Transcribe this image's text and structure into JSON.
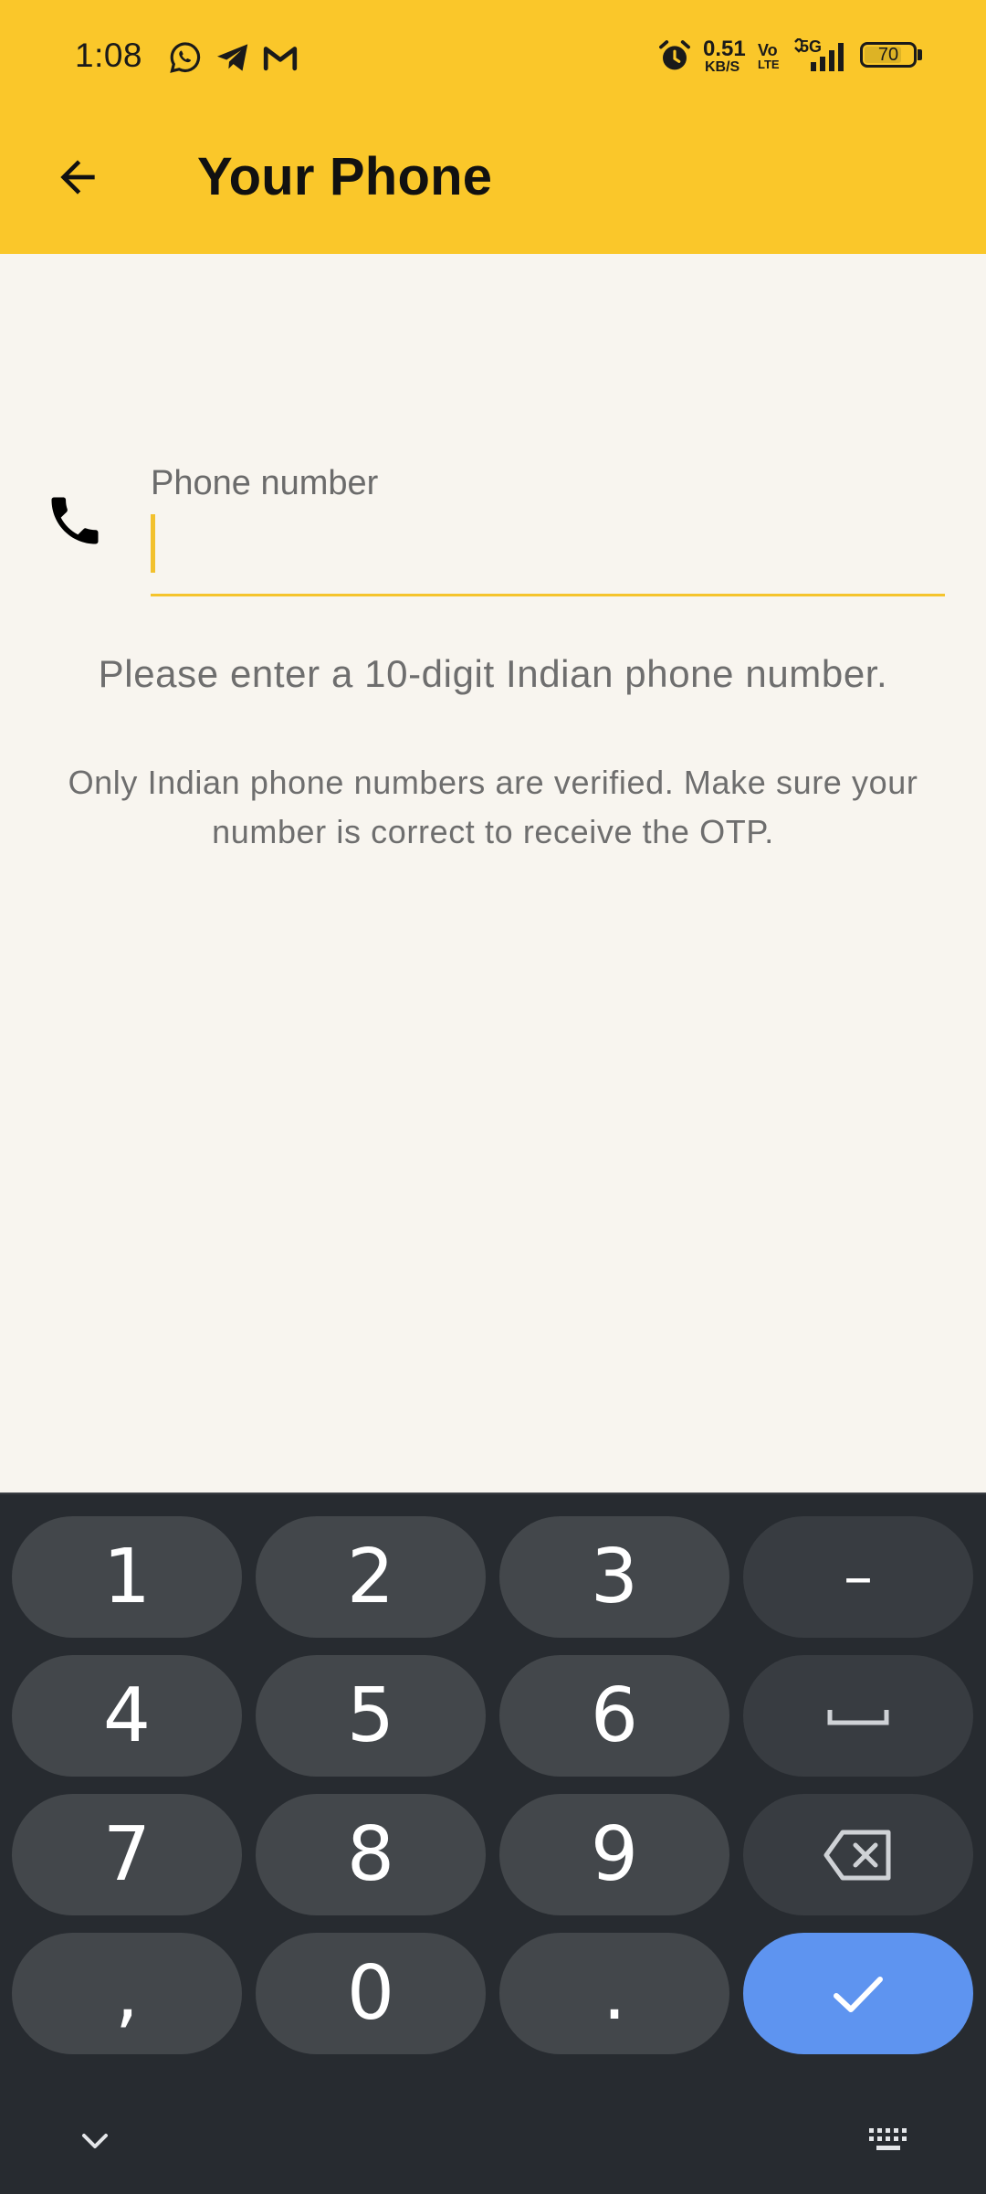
{
  "status_bar": {
    "time": "1:08",
    "notification_icons": [
      "whatsapp-icon",
      "telegram-icon",
      "gmail-icon"
    ],
    "alarm_icon": "alarm-icon",
    "net_speed_value": "0.51",
    "net_speed_unit": "KB/S",
    "volte_top": "Vo",
    "volte_bottom": "LTE",
    "network_label": "5G",
    "battery_level": "70"
  },
  "app_bar": {
    "title": "Your Phone",
    "back_icon": "arrow-back-icon",
    "color": "#FAC72A"
  },
  "form": {
    "phone_label": "Phone number",
    "phone_value": "",
    "phone_icon": "phone-icon",
    "helper_text": "Please enter a 10-digit Indian phone number.",
    "note_text": "Only Indian phone numbers are verified. Make sure your number is correct to receive the OTP.",
    "accent_color": "#F5C42C"
  },
  "keyboard": {
    "keys": {
      "k1": "1",
      "k2": "2",
      "k3": "3",
      "dash": "–",
      "k4": "4",
      "k5": "5",
      "k6": "6",
      "k7": "7",
      "k8": "8",
      "k9": "9",
      "comma": ",",
      "k0": "0",
      "period": "."
    },
    "space_icon": "space-icon",
    "backspace_icon": "backspace-icon",
    "done_icon": "check-icon",
    "hide_icon": "chevron-down-icon",
    "switch_icon": "keyboard-icon",
    "action_color": "#5E94F0"
  }
}
